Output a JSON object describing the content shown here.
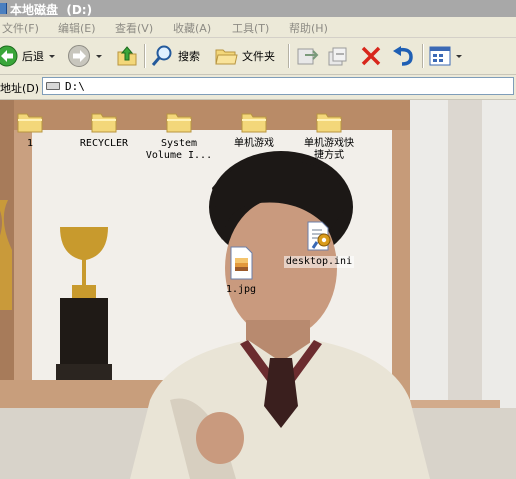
{
  "window": {
    "title": "本地磁盘  (D:)"
  },
  "menu": [
    {
      "label": "文件(F)"
    },
    {
      "label": "编辑(E)"
    },
    {
      "label": "查看(V)"
    },
    {
      "label": "收藏(A)"
    },
    {
      "label": "工具(T)"
    },
    {
      "label": "帮助(H)"
    }
  ],
  "toolbar": {
    "back_label": "后退",
    "search_label": "搜索",
    "folders_label": "文件夹"
  },
  "address": {
    "label": "地址(D)",
    "path": "D:\\"
  },
  "files": [
    {
      "name": "1",
      "type": "folder"
    },
    {
      "name": "RECYCLER",
      "type": "folder"
    },
    {
      "name": "System\nVolume I...",
      "type": "folder"
    },
    {
      "name": "单机游戏",
      "type": "folder"
    },
    {
      "name": "单机游戏快\n捷方式",
      "type": "folder"
    },
    {
      "name": "1.jpg",
      "type": "image"
    },
    {
      "name": "desktop.ini",
      "type": "settings"
    }
  ],
  "colors": {
    "folder": "#f3d77a",
    "delete": "#d8261b",
    "address_border": "#7f9db9"
  }
}
